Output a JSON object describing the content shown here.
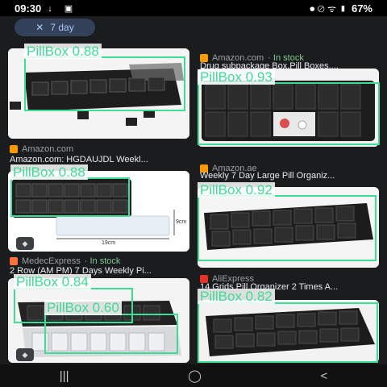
{
  "status": {
    "time": "09:30",
    "left_icons": "↓ ▣",
    "right_icons": "⏺ ⊘ ᯤ ▮",
    "battery": "67%"
  },
  "filter_chip": {
    "close": "✕",
    "label": "7 day"
  },
  "cards": [
    {
      "source": "Amazon.com",
      "title": "Amazon.com: HGDAUJDL Weekl...",
      "detection": "PillBox 0.88"
    },
    {
      "source": "Amazon.com",
      "instock": "· In stock",
      "title": "Drug subpackage Box,Pill Boxes,...",
      "detection": "PillBox 0.93"
    },
    {
      "source": "",
      "title": "",
      "detection": "PillBox 0.88",
      "measure_w": "19cm",
      "measure_h": "9cm"
    },
    {
      "source": "Amazon.ae",
      "title": "Weekly 7 Day Large Pill Organiz...",
      "detection": "PillBox 0.92"
    },
    {
      "source": "MedecExpress",
      "instock": "· In stock",
      "title": "2 Row (AM PM) 7 Days Weekly Pi...",
      "detection": "PillBox 0.84",
      "detection2": "PillBox 0.60"
    },
    {
      "source": "AliExpress",
      "title": "14 Grids Pill Organizer 2 Times A...",
      "detection": "PillBox 0.82"
    }
  ],
  "nav": {
    "recents": "|||",
    "home": "◯",
    "back": "<"
  },
  "colors": {
    "detection": "#3ddc97",
    "instock": "#81c995",
    "chip_bg": "#34415a"
  }
}
